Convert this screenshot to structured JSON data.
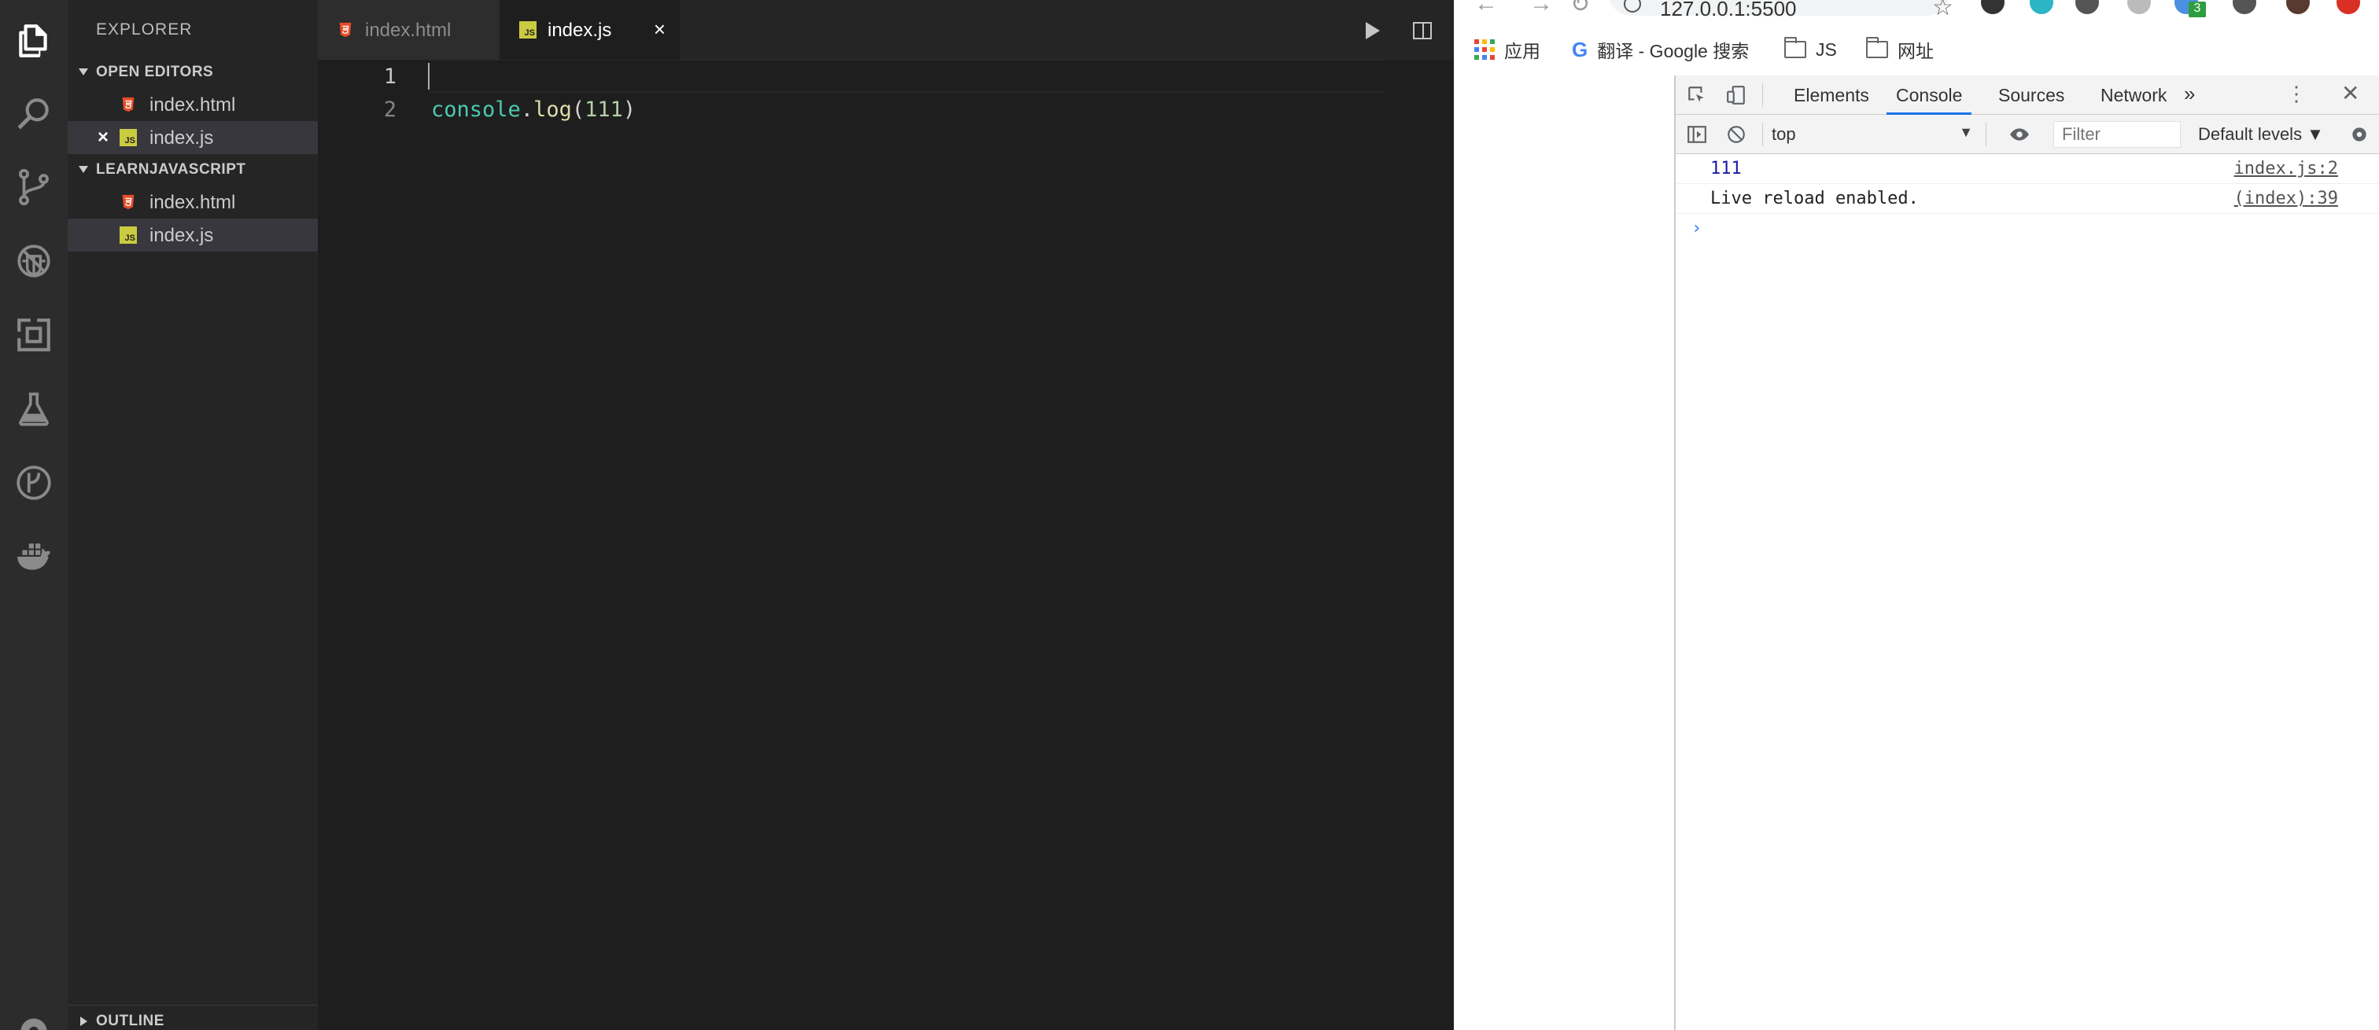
{
  "vscode": {
    "activity_bar": [
      "files-icon",
      "search-icon",
      "source-control-icon",
      "debug-icon",
      "extensions-icon",
      "test-flask-icon",
      "gitlens-icon",
      "docker-icon",
      "settings-gear-icon"
    ],
    "sidebar": {
      "title": "EXPLORER",
      "open_editors_label": "OPEN EDITORS",
      "open_editors": [
        {
          "name": "index.html",
          "type": "html"
        },
        {
          "name": "index.js",
          "type": "js"
        }
      ],
      "project_label": "LEARNJAVASCRIPT",
      "project_files": [
        {
          "name": "index.html",
          "type": "html"
        },
        {
          "name": "index.js",
          "type": "js"
        }
      ],
      "outline_label": "OUTLINE"
    },
    "tabs": [
      {
        "label": "index.html",
        "active": false
      },
      {
        "label": "index.js",
        "active": true,
        "close": "×"
      }
    ],
    "editor": {
      "line_numbers": [
        "1",
        "2"
      ],
      "line2": {
        "obj": "console",
        "dot": ".",
        "fn": "log",
        "open": "(",
        "arg": "111",
        "close": ")"
      }
    },
    "js_badge": "JS"
  },
  "chrome": {
    "url": "127.0.0.1:5500",
    "bookmarks": [
      {
        "label": "应用",
        "icon": "apps-grid-icon"
      },
      {
        "label": "翻译 - Google 搜索",
        "icon": "google-icon"
      },
      {
        "label": "JS",
        "icon": "folder-icon"
      },
      {
        "label": "网址",
        "icon": "folder-icon"
      }
    ],
    "extension_badge": "3",
    "devtools": {
      "tabs": [
        "Elements",
        "Console",
        "Sources",
        "Network"
      ],
      "active_tab": "Console",
      "context": "top",
      "filter_placeholder": "Filter",
      "levels": "Default levels ▼",
      "logs": [
        {
          "message": "111",
          "source": "index.js:2"
        },
        {
          "message": "Live reload enabled.",
          "source": "(index):39"
        }
      ],
      "prompt": "›"
    }
  },
  "colors": {
    "vscode_bg": "#1e1e1e",
    "sidebar_bg": "#252526",
    "activity_bg": "#2c2c2c",
    "accent_blue": "#1a73e8"
  }
}
